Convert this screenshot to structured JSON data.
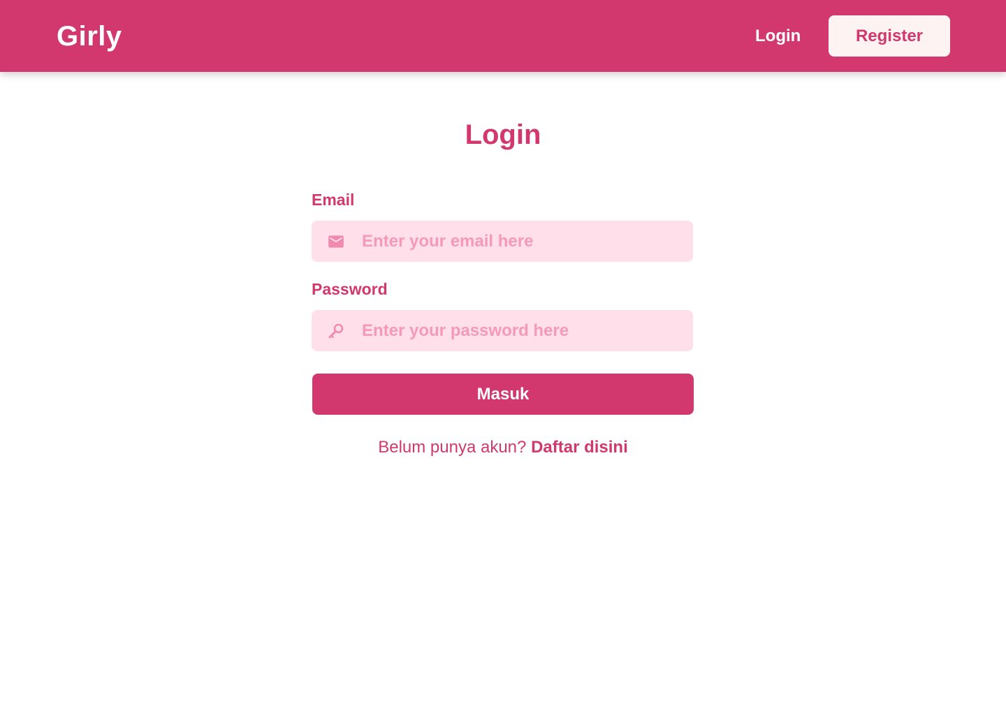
{
  "colors": {
    "primary": "#d2386d",
    "register_button_bg": "#fdf3f3",
    "input_bg": "#ffe0ea",
    "placeholder": "#f49ab8",
    "background": "#ffffff"
  },
  "navbar": {
    "brand": "Girly",
    "login_label": "Login",
    "register_label": "Register"
  },
  "main": {
    "title": "Login",
    "email": {
      "label": "Email",
      "placeholder": "Enter your email here",
      "value": "",
      "icon": "mail-icon"
    },
    "password": {
      "label": "Password",
      "placeholder": "Enter your password here",
      "value": "",
      "icon": "key-icon"
    },
    "submit_label": "Masuk",
    "register_prompt": "Belum punya akun?",
    "register_link": "Daftar disini"
  }
}
